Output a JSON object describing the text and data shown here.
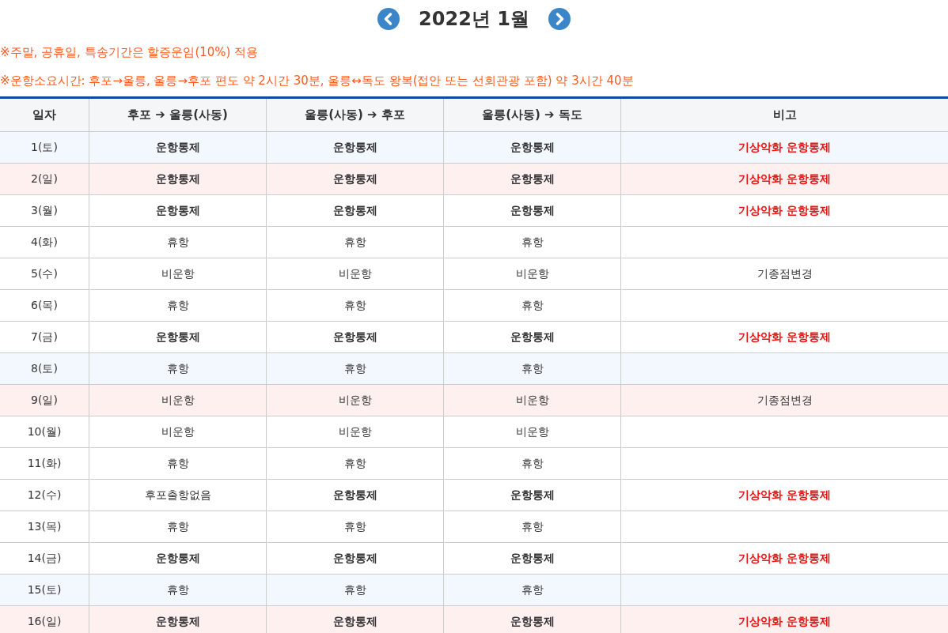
{
  "month_nav": {
    "title": "2022년 1월"
  },
  "notes": [
    "※주말, 공휴일, 특송기간은 할증운임(10%) 적용",
    "※운항소요시간: 후포→울릉, 울릉→후포 편도 약 2시간 30분, 울릉↔독도 왕복(접안 또는 선회관광 포함) 약 3시간 40분"
  ],
  "table": {
    "columns": [
      "일자",
      "후포 ➔ 울릉(사동)",
      "울릉(사동) ➔ 후포",
      "울릉(사동) ➔ 독도",
      "비고"
    ],
    "rows": [
      {
        "color": "#f3f8ff",
        "cells": [
          {
            "text": "1(토)",
            "kind": "plain"
          },
          {
            "text": "운항통제",
            "kind": "bold"
          },
          {
            "text": "운항통제",
            "kind": "bold"
          },
          {
            "text": "운항통제",
            "kind": "bold"
          },
          {
            "text": "기상악화 운항통제",
            "kind": "alert"
          }
        ]
      },
      {
        "color": "#fff0f0",
        "cells": [
          {
            "text": "2(일)",
            "kind": "plain"
          },
          {
            "text": "운항통제",
            "kind": "bold"
          },
          {
            "text": "운항통제",
            "kind": "bold"
          },
          {
            "text": "운항통제",
            "kind": "bold"
          },
          {
            "text": "기상악화 운항통제",
            "kind": "alert"
          }
        ]
      },
      {
        "color": "#ffffff",
        "cells": [
          {
            "text": "3(월)",
            "kind": "plain"
          },
          {
            "text": "운항통제",
            "kind": "bold"
          },
          {
            "text": "운항통제",
            "kind": "bold"
          },
          {
            "text": "운항통제",
            "kind": "bold"
          },
          {
            "text": "기상악화 운항통제",
            "kind": "alert"
          }
        ]
      },
      {
        "color": "#ffffff",
        "cells": [
          {
            "text": "4(화)",
            "kind": "plain"
          },
          {
            "text": "휴항",
            "kind": "plain"
          },
          {
            "text": "휴항",
            "kind": "plain"
          },
          {
            "text": "휴항",
            "kind": "plain"
          },
          ""
        ]
      },
      {
        "color": "#ffffff",
        "cells": [
          {
            "text": "5(수)",
            "kind": "plain"
          },
          {
            "text": "비운항",
            "kind": "plain"
          },
          {
            "text": "비운항",
            "kind": "plain"
          },
          {
            "text": "비운항",
            "kind": "plain"
          },
          {
            "text": "기종점변경",
            "kind": "plain"
          }
        ]
      },
      {
        "color": "#ffffff",
        "cells": [
          {
            "text": "6(목)",
            "kind": "plain"
          },
          {
            "text": "휴항",
            "kind": "plain"
          },
          {
            "text": "휴항",
            "kind": "plain"
          },
          {
            "text": "휴항",
            "kind": "plain"
          },
          ""
        ]
      },
      {
        "color": "#ffffff",
        "cells": [
          {
            "text": "7(금)",
            "kind": "plain"
          },
          {
            "text": "운항통제",
            "kind": "bold"
          },
          {
            "text": "운항통제",
            "kind": "bold"
          },
          {
            "text": "운항통제",
            "kind": "bold"
          },
          {
            "text": "기상악화 운항통제",
            "kind": "alert"
          }
        ]
      },
      {
        "color": "#f3f8ff",
        "cells": [
          {
            "text": "8(토)",
            "kind": "plain"
          },
          {
            "text": "휴항",
            "kind": "plain"
          },
          {
            "text": "휴항",
            "kind": "plain"
          },
          {
            "text": "휴항",
            "kind": "plain"
          },
          ""
        ]
      },
      {
        "color": "#fff0f0",
        "cells": [
          {
            "text": "9(일)",
            "kind": "plain"
          },
          {
            "text": "비운항",
            "kind": "plain"
          },
          {
            "text": "비운항",
            "kind": "plain"
          },
          {
            "text": "비운항",
            "kind": "plain"
          },
          {
            "text": "기종점변경",
            "kind": "plain"
          }
        ]
      },
      {
        "color": "#ffffff",
        "cells": [
          {
            "text": "10(월)",
            "kind": "plain"
          },
          {
            "text": "비운항",
            "kind": "plain"
          },
          {
            "text": "비운항",
            "kind": "plain"
          },
          {
            "text": "비운항",
            "kind": "plain"
          },
          ""
        ]
      },
      {
        "color": "#ffffff",
        "cells": [
          {
            "text": "11(화)",
            "kind": "plain"
          },
          {
            "text": "휴항",
            "kind": "plain"
          },
          {
            "text": "휴항",
            "kind": "plain"
          },
          {
            "text": "휴항",
            "kind": "plain"
          },
          ""
        ]
      },
      {
        "color": "#ffffff",
        "cells": [
          {
            "text": "12(수)",
            "kind": "plain"
          },
          {
            "text": "후포출항없음",
            "kind": "plain"
          },
          {
            "text": "운항통제",
            "kind": "bold"
          },
          {
            "text": "운항통제",
            "kind": "bold"
          },
          {
            "text": "기상악화 운항통제",
            "kind": "alert"
          }
        ]
      },
      {
        "color": "#ffffff",
        "cells": [
          {
            "text": "13(목)",
            "kind": "plain"
          },
          {
            "text": "휴항",
            "kind": "plain"
          },
          {
            "text": "휴항",
            "kind": "plain"
          },
          {
            "text": "휴항",
            "kind": "plain"
          },
          ""
        ]
      },
      {
        "color": "#ffffff",
        "cells": [
          {
            "text": "14(금)",
            "kind": "plain"
          },
          {
            "text": "운항통제",
            "kind": "bold"
          },
          {
            "text": "운항통제",
            "kind": "bold"
          },
          {
            "text": "운항통제",
            "kind": "bold"
          },
          {
            "text": "기상악화 운항통제",
            "kind": "alert"
          }
        ]
      },
      {
        "color": "#f3f8ff",
        "cells": [
          {
            "text": "15(토)",
            "kind": "plain"
          },
          {
            "text": "휴항",
            "kind": "plain"
          },
          {
            "text": "휴항",
            "kind": "plain"
          },
          {
            "text": "휴항",
            "kind": "plain"
          },
          ""
        ]
      },
      {
        "color": "#fff0f0",
        "cells": [
          {
            "text": "16(일)",
            "kind": "plain"
          },
          {
            "text": "운항통제",
            "kind": "bold"
          },
          {
            "text": "운항통제",
            "kind": "bold"
          },
          {
            "text": "운항통제",
            "kind": "bold"
          },
          {
            "text": "기상악화 운항통제",
            "kind": "alert"
          }
        ]
      }
    ]
  }
}
